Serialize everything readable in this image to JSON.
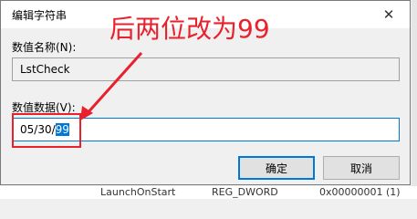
{
  "dialog": {
    "title": "编辑字符串",
    "close_glyph": "✕"
  },
  "value_name": {
    "label": "数值名称(N):",
    "value": "LstCheck"
  },
  "value_data": {
    "label": "数值数据(V):",
    "value_unselected": "05/30/",
    "value_selected": "99"
  },
  "buttons": {
    "ok": "确定",
    "cancel": "取消"
  },
  "annotation": {
    "text": "后两位改为99",
    "color": "#e8212d"
  },
  "background_row": {
    "name": "LaunchOnStart",
    "type": "REG_DWORD",
    "data": "0x00000001 (1)"
  },
  "colors": {
    "accent": "#0078d7",
    "annotation": "#e8212d"
  }
}
